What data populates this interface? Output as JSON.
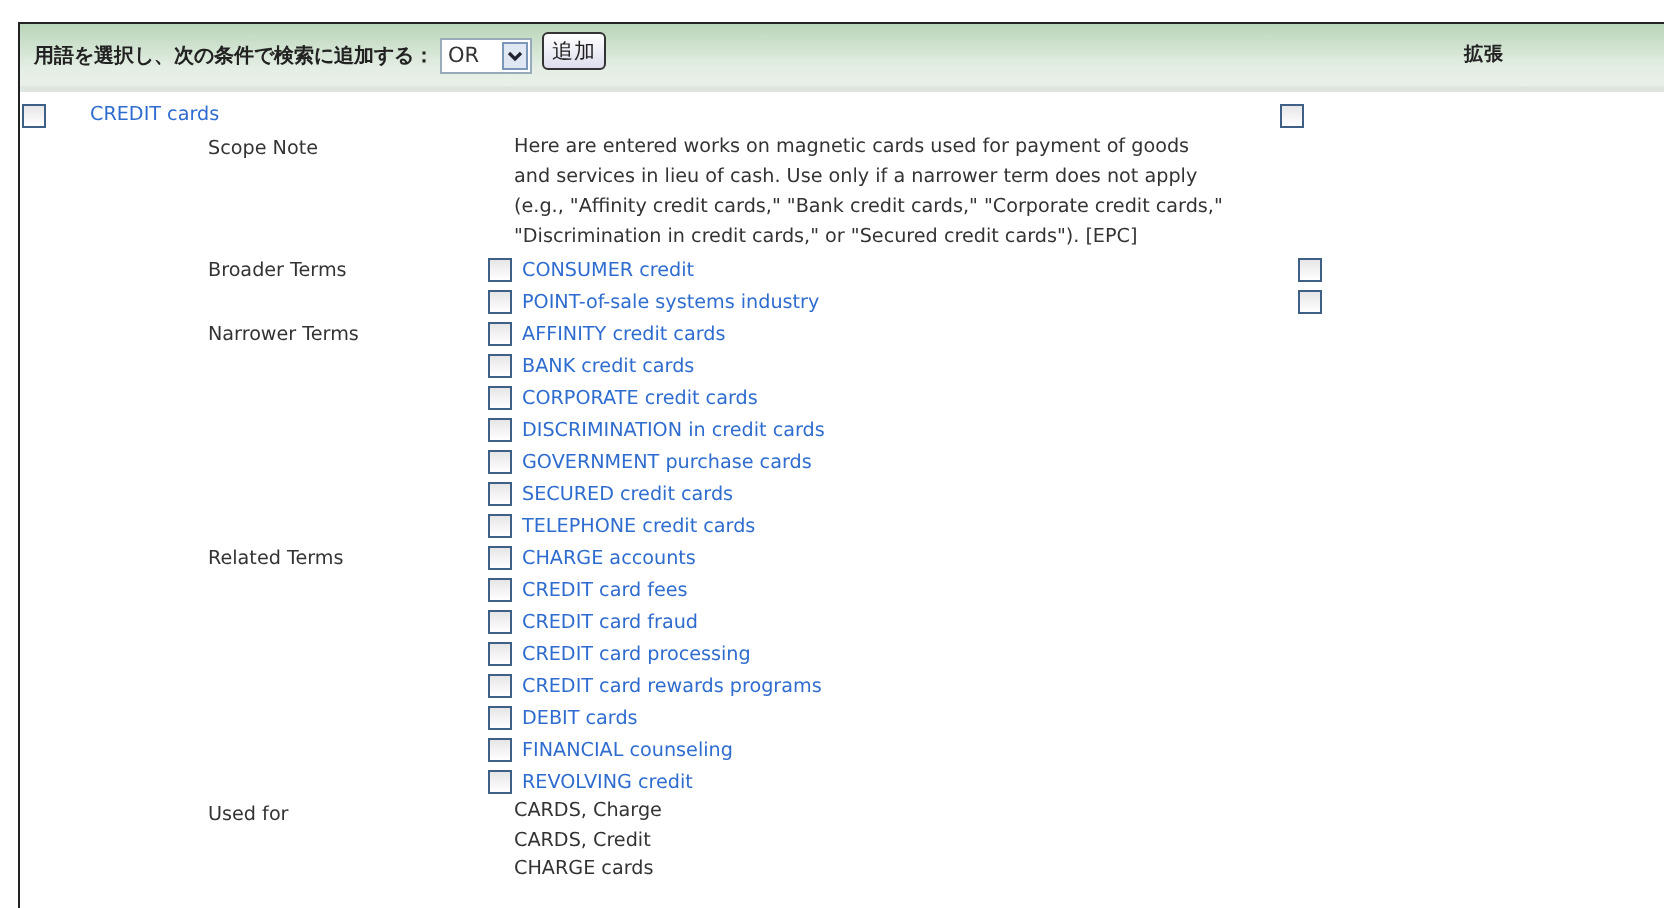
{
  "header": {
    "label": "用語を選択し、次の条件で検索に追加する：",
    "operator": "OR",
    "add_button": "追加",
    "extend_label": "拡張"
  },
  "term": {
    "label": "CREDIT cards",
    "checked": false,
    "extend_checked": false
  },
  "sections": [
    {
      "label": "Scope Note",
      "kind": "note",
      "text": "Here are entered works on magnetic cards used for payment of goods and services in lieu of cash. Use only if a narrower term does not apply (e.g., \"Affinity credit cards,\" \"Bank credit cards,\" \"Corporate credit cards,\" \"Discrimination in credit cards,\" or \"Secured credit cards\"). [EPC]"
    },
    {
      "label": "Broader Terms",
      "kind": "links",
      "items": [
        {
          "label": "CONSUMER credit",
          "checked": false,
          "extend_checked": false
        },
        {
          "label": "POINT-of-sale systems industry",
          "checked": false,
          "extend_checked": false
        }
      ]
    },
    {
      "label": "Narrower Terms",
      "kind": "links",
      "items": [
        {
          "label": "AFFINITY credit cards",
          "checked": false
        },
        {
          "label": "BANK credit cards",
          "checked": false
        },
        {
          "label": "CORPORATE credit cards",
          "checked": false
        },
        {
          "label": "DISCRIMINATION in credit cards",
          "checked": false
        },
        {
          "label": "GOVERNMENT purchase cards",
          "checked": false
        },
        {
          "label": "SECURED credit cards",
          "checked": false
        },
        {
          "label": "TELEPHONE credit cards",
          "checked": false
        }
      ]
    },
    {
      "label": "Related Terms",
      "kind": "links",
      "items": [
        {
          "label": "CHARGE accounts",
          "checked": false
        },
        {
          "label": "CREDIT card fees",
          "checked": false
        },
        {
          "label": "CREDIT card fraud",
          "checked": false
        },
        {
          "label": "CREDIT card processing",
          "checked": false
        },
        {
          "label": "CREDIT card rewards programs",
          "checked": false
        },
        {
          "label": "DEBIT cards",
          "checked": false
        },
        {
          "label": "FINANCIAL counseling",
          "checked": false
        },
        {
          "label": "REVOLVING credit",
          "checked": false
        }
      ]
    },
    {
      "label": "Used for",
      "kind": "plain",
      "items": [
        "CARDS, Charge",
        "CARDS, Credit",
        "CHARGE cards"
      ]
    }
  ]
}
